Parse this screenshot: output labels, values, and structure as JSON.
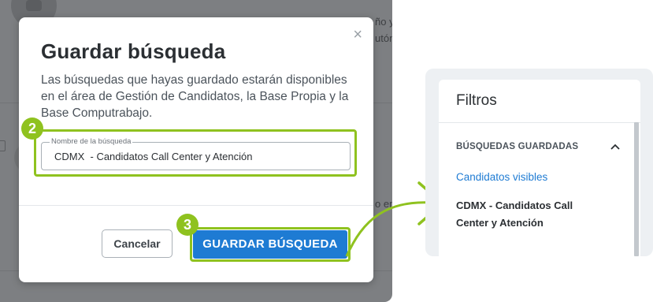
{
  "background": {
    "text_1": "ño y",
    "text_2": "utón",
    "text_3": "o en"
  },
  "modal": {
    "close": "×",
    "title": "Guardar búsqueda",
    "description": "Las búsquedas que hayas guardado estarán disponibles en el área de Gestión de Candidatos, la Base Propia y la Base Computrabajo.",
    "field_label": "Nombre de la búsqueda",
    "field_value": "CDMX  - Candidatos Call Center y Atención",
    "cancel_label": "Cancelar",
    "save_label": "GUARDAR BÚSQUEDA"
  },
  "steps": {
    "step_2": "2",
    "step_3": "3"
  },
  "filters_panel": {
    "title": "Filtros",
    "section": "BÚSQUEDAS GUARDADAS",
    "section_icon": "chevron-up-icon",
    "link": "Candidatos visibles",
    "saved_item": "CDMX - Candidatos Call Center y Atención"
  },
  "colors": {
    "accent_green": "#8fc21f",
    "primary_blue": "#1e7bd3",
    "overlay": "#7d7f82"
  }
}
